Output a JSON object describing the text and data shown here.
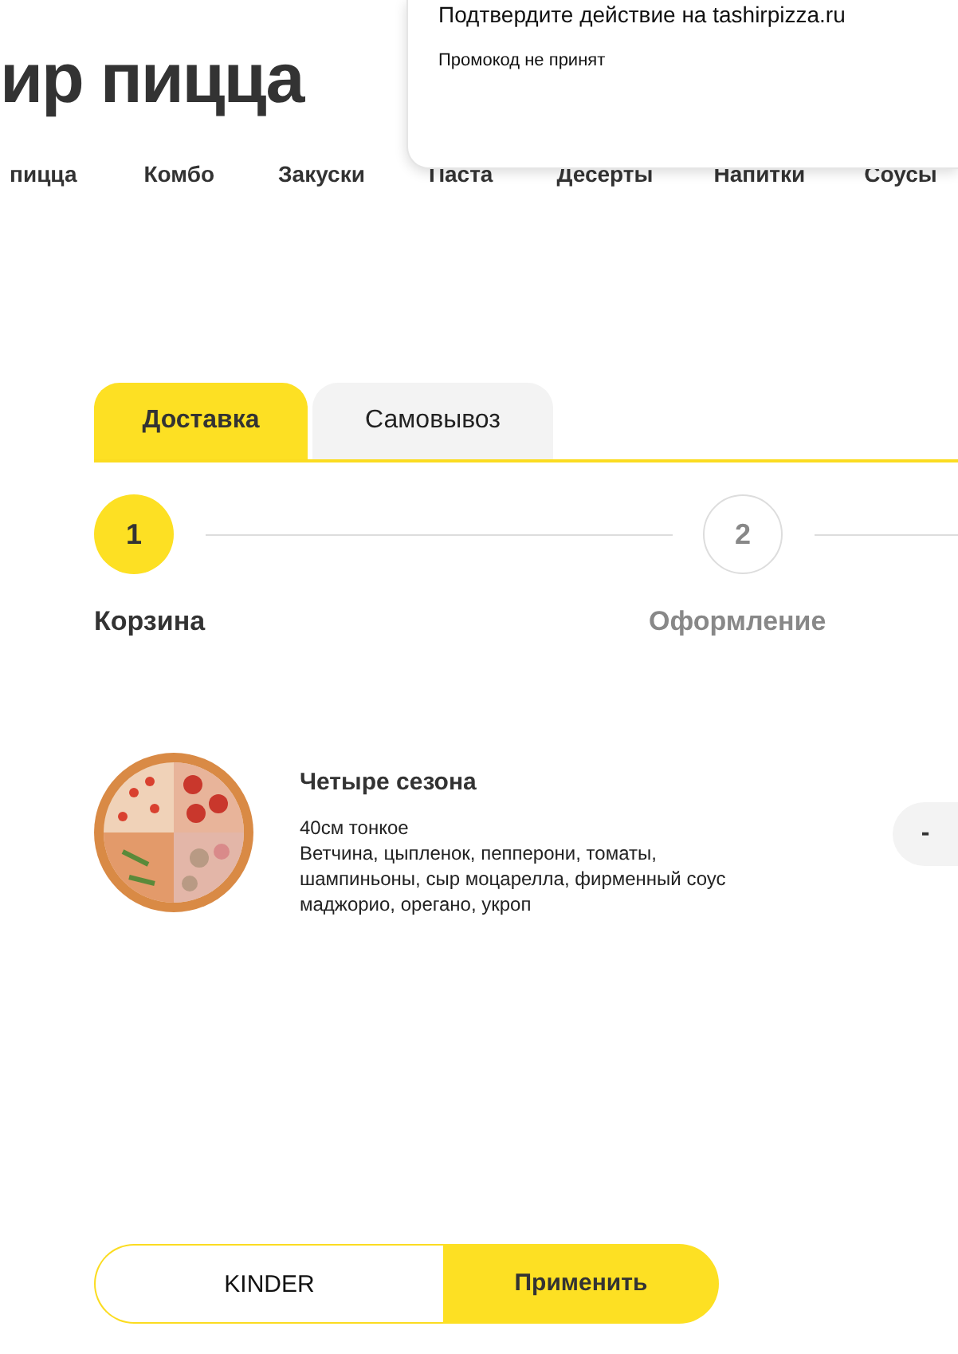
{
  "logo": {
    "text": "ир пицца"
  },
  "nav": [
    "пицца",
    "Комбо",
    "Закуски",
    "Паста",
    "Десерты",
    "Напитки",
    "Соусы"
  ],
  "dialog": {
    "title": "Подтвердите действие на tashirpizza.ru",
    "message": "Промокод не принят"
  },
  "tabs": [
    {
      "label": "Доставка",
      "selected": true
    },
    {
      "label": "Самовывоз",
      "selected": false
    }
  ],
  "steps": [
    {
      "number": "1",
      "label": "Корзина",
      "selected": true
    },
    {
      "number": "2",
      "label": "Оформление",
      "selected": false
    }
  ],
  "cart_items": [
    {
      "name": "Четыре сезона",
      "size": "40см тонкое",
      "ingredients": "Ветчина, цыпленок, пепперони, томаты, шампиньоны, сыр моцарелла, фирменный соус маджорио, орегано, укроп",
      "decrease": "-"
    }
  ],
  "promo": {
    "value": "KINDER",
    "button": "Применить"
  }
}
